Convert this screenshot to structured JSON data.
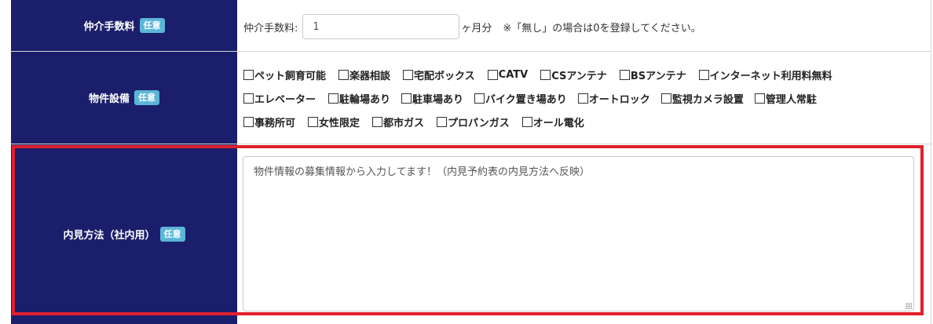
{
  "rows": {
    "brokerage_fee": {
      "label": "仲介手数料",
      "badge": "任意",
      "field_label": "仲介手数料:",
      "value": "1",
      "unit": "ヶ月分",
      "note": "※「無し」の場合は0を登録してください。"
    },
    "facilities": {
      "label": "物件設備",
      "badge": "任意",
      "items": [
        {
          "label": "ペット飼育可能",
          "checked": true
        },
        {
          "label": "楽器相談",
          "checked": false
        },
        {
          "label": "宅配ボックス",
          "checked": false
        },
        {
          "label": "CATV",
          "checked": false
        },
        {
          "label": "CSアンテナ",
          "checked": false
        },
        {
          "label": "BSアンテナ",
          "checked": false
        },
        {
          "label": "インターネット利用料無料",
          "checked": false
        },
        {
          "label": "エレベーター",
          "checked": true
        },
        {
          "label": "駐輪場あり",
          "checked": true
        },
        {
          "label": "駐車場あり",
          "checked": true
        },
        {
          "label": "バイク置き場あり",
          "checked": true
        },
        {
          "label": "オートロック",
          "checked": true
        },
        {
          "label": "監視カメラ設置",
          "checked": true
        },
        {
          "label": "管理人常駐",
          "checked": false
        },
        {
          "label": "事務所可",
          "checked": false
        },
        {
          "label": "女性限定",
          "checked": false
        },
        {
          "label": "都市ガス",
          "checked": false
        },
        {
          "label": "プロパンガス",
          "checked": false
        },
        {
          "label": "オール電化",
          "checked": false
        }
      ]
    },
    "viewing_method": {
      "label": "内見方法（社内用）",
      "badge": "任意",
      "text": "物件情報の募集情報から入力してます！（内見予約表の内見方法へ反映）"
    }
  },
  "colors": {
    "label_bg": "#1b1f6b",
    "badge_bg": "#5bb6d8",
    "highlight": "#e0202e"
  }
}
